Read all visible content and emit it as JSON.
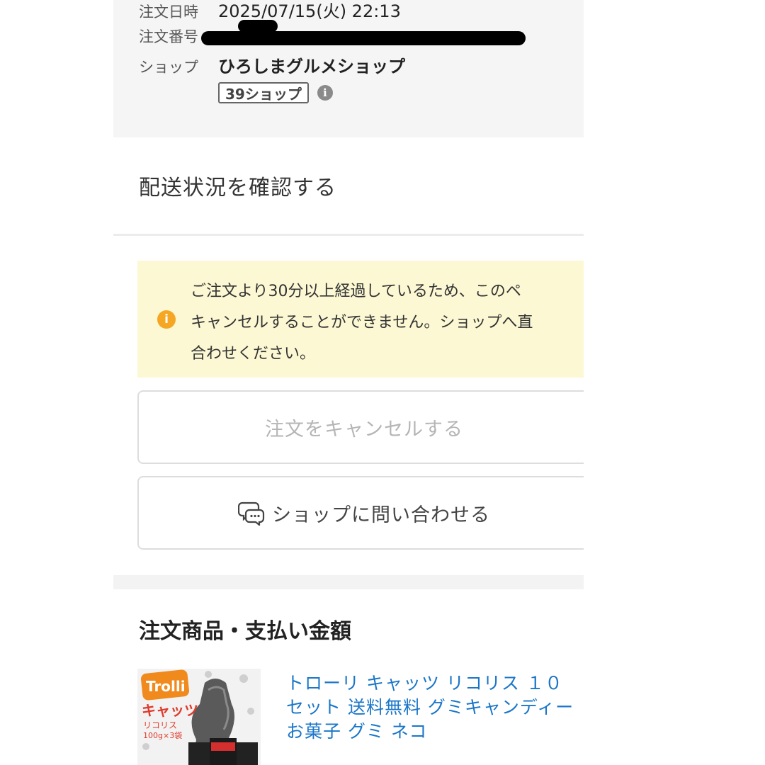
{
  "order": {
    "date_label": "注文日時",
    "date_value": "2025/07/15(火) 22:13",
    "number_label": "注文番号",
    "shop_label": "ショップ",
    "shop_name": "ひろしまグルメショップ",
    "badge": "39ショップ",
    "badge_info_icon": "info-icon"
  },
  "delivery": {
    "label": "配送状況を確認する"
  },
  "notice": {
    "icon": "warning-info-icon",
    "line1": "ご注文より30分以上経過しているため、このペ",
    "line2": "キャンセルすることができません。ショップへ直",
    "line3": "合わせください。"
  },
  "buttons": {
    "cancel_label": "注文をキャンセルする",
    "contact_label": "ショップに問い合わせる",
    "contact_icon": "chat-bubbles-icon"
  },
  "section": {
    "title": "注文商品・支払い金額"
  },
  "product": {
    "line1": "トローリ キャッツ リコリス １０",
    "line2": "セット 送料無料 グミキャンディー",
    "line3": "お菓子 グミ ネコ",
    "image_brand": "Trolli",
    "image_text": "キャッツ",
    "image_sub": "リコリス",
    "image_qty": "100g×3袋"
  },
  "colors": {
    "link": "#1a76c8",
    "notice_bg": "#fcf8d4",
    "warning": "#f5a623",
    "brand_orange": "#f08a1c"
  }
}
